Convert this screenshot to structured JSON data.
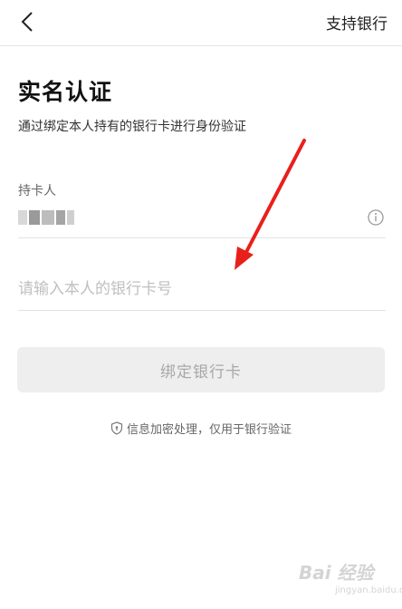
{
  "header": {
    "back_icon": "chevron-left-icon",
    "support_link": "支持银行"
  },
  "main": {
    "title": "实名认证",
    "subtitle": "通过绑定本人持有的银行卡进行身份验证",
    "cardholder": {
      "label": "持卡人",
      "value_masked": true,
      "info_icon": "info-icon"
    },
    "card_number": {
      "placeholder": "请输入本人的银行卡号",
      "value": ""
    },
    "bind_button": "绑定银行卡",
    "security_note": "信息加密处理，仅用于银行验证",
    "security_icon": "shield-icon"
  },
  "watermark": {
    "brand": "Bai 经验",
    "url": "jingyan.baidu.com"
  },
  "colors": {
    "annotation_arrow": "#e8201b",
    "button_bg": "#eeeeee",
    "button_text": "#a8a8a8"
  }
}
